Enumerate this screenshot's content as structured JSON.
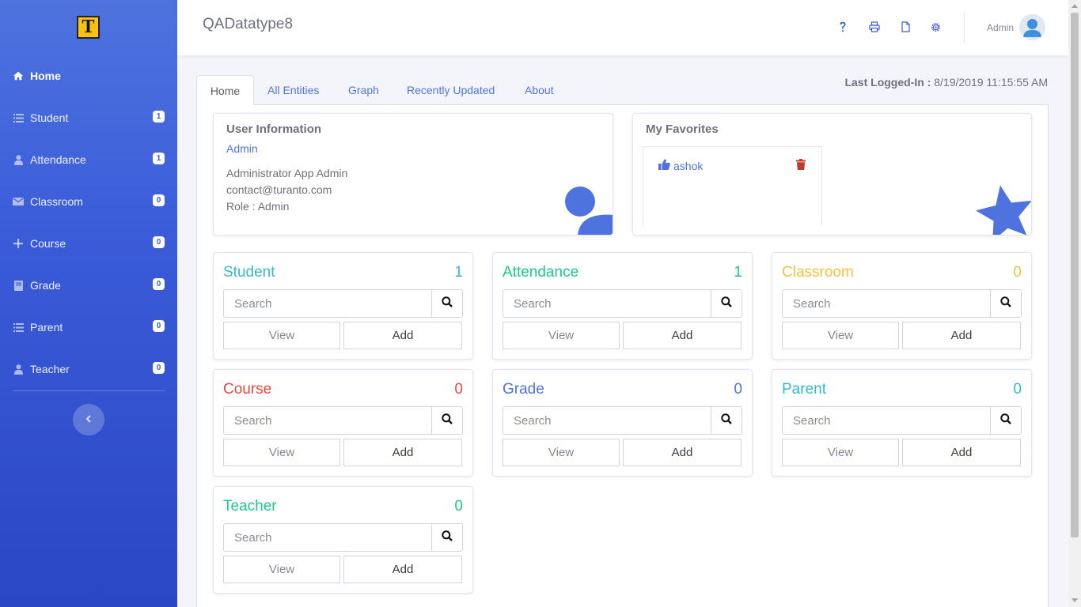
{
  "app": {
    "title": "QADatatype8",
    "logo_letter": "T"
  },
  "sidebar": {
    "items": [
      {
        "label": "Home",
        "icon": "home-icon"
      },
      {
        "label": "Student",
        "icon": "list-icon",
        "badge": "1"
      },
      {
        "label": "Attendance",
        "icon": "user-icon",
        "badge": "1"
      },
      {
        "label": "Classroom",
        "icon": "envelope-icon",
        "badge": "0"
      },
      {
        "label": "Course",
        "icon": "plus-icon",
        "badge": "0"
      },
      {
        "label": "Grade",
        "icon": "book-icon",
        "badge": "0"
      },
      {
        "label": "Parent",
        "icon": "list-icon",
        "badge": "0"
      },
      {
        "label": "Teacher",
        "icon": "user-icon",
        "badge": "0"
      }
    ],
    "collapse_icon": "chevron-left-icon"
  },
  "topbar": {
    "icons": [
      "question-icon",
      "print-icon",
      "file-icon",
      "gear-icon"
    ],
    "user_name": "Admin"
  },
  "tabs": [
    "Home",
    "All Entities",
    "Graph",
    "Recently Updated",
    "About"
  ],
  "last_logged": {
    "label": "Last Logged-In :",
    "value": "8/19/2019 11:15:55 AM"
  },
  "user_info": {
    "title": "User Information",
    "name": "Admin",
    "full_name": "Administrator App Admin",
    "email": "contact@turanto.com",
    "role": "Role : Admin"
  },
  "favorites": {
    "title": "My Favorites",
    "items": [
      {
        "label": "ashok"
      }
    ]
  },
  "entities": [
    {
      "title": "Student",
      "count": "1",
      "color": "#36b9cc",
      "search_placeholder": "Search",
      "view_label": "View",
      "add_label": "Add"
    },
    {
      "title": "Attendance",
      "count": "1",
      "color": "#1cc88a",
      "search_placeholder": "Search",
      "view_label": "View",
      "add_label": "Add"
    },
    {
      "title": "Classroom",
      "count": "0",
      "color": "#f6c23e",
      "search_placeholder": "Search",
      "view_label": "View",
      "add_label": "Add"
    },
    {
      "title": "Course",
      "count": "0",
      "color": "#e74a3b",
      "search_placeholder": "Search",
      "view_label": "View",
      "add_label": "Add"
    },
    {
      "title": "Grade",
      "count": "0",
      "color": "#4e73df",
      "search_placeholder": "Search",
      "view_label": "View",
      "add_label": "Add"
    },
    {
      "title": "Parent",
      "count": "0",
      "color": "#36b9cc",
      "search_placeholder": "Search",
      "view_label": "View",
      "add_label": "Add"
    },
    {
      "title": "Teacher",
      "count": "0",
      "color": "#1cc88a",
      "search_placeholder": "Search",
      "view_label": "View",
      "add_label": "Add"
    }
  ],
  "colors": {
    "accent": "#4e73df",
    "sidebar_top": "#4e73df",
    "sidebar_bottom": "#2a47c4"
  }
}
